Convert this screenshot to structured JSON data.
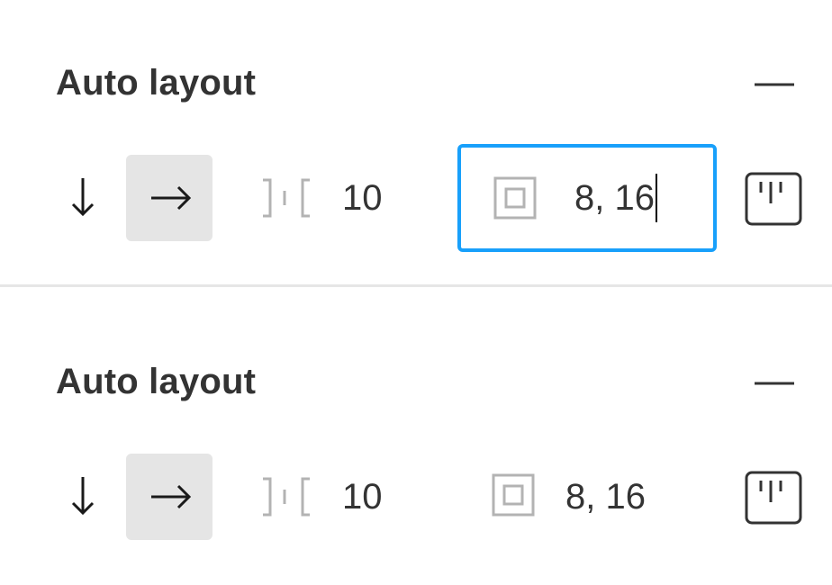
{
  "panels": [
    {
      "state": "editing",
      "title": "Auto layout",
      "spacing_value": "10",
      "padding_value": "8, 16",
      "direction_selected": "horizontal"
    },
    {
      "state": "default",
      "title": "Auto layout",
      "spacing_value": "10",
      "padding_value": "8, 16",
      "direction_selected": "horizontal"
    }
  ],
  "icons": {
    "remove": "minus-icon",
    "direction_vertical": "arrow-down-icon",
    "direction_horizontal": "arrow-right-icon",
    "spacing": "spacing-between-items-icon",
    "padding": "padding-icon",
    "alignment": "alignment-icon"
  },
  "colors": {
    "focus_border": "#18a0fb",
    "selected_bg": "#e5e5e5",
    "text": "#333333",
    "icon_muted": "#b3b3b3",
    "divider": "#e6e6e6"
  }
}
